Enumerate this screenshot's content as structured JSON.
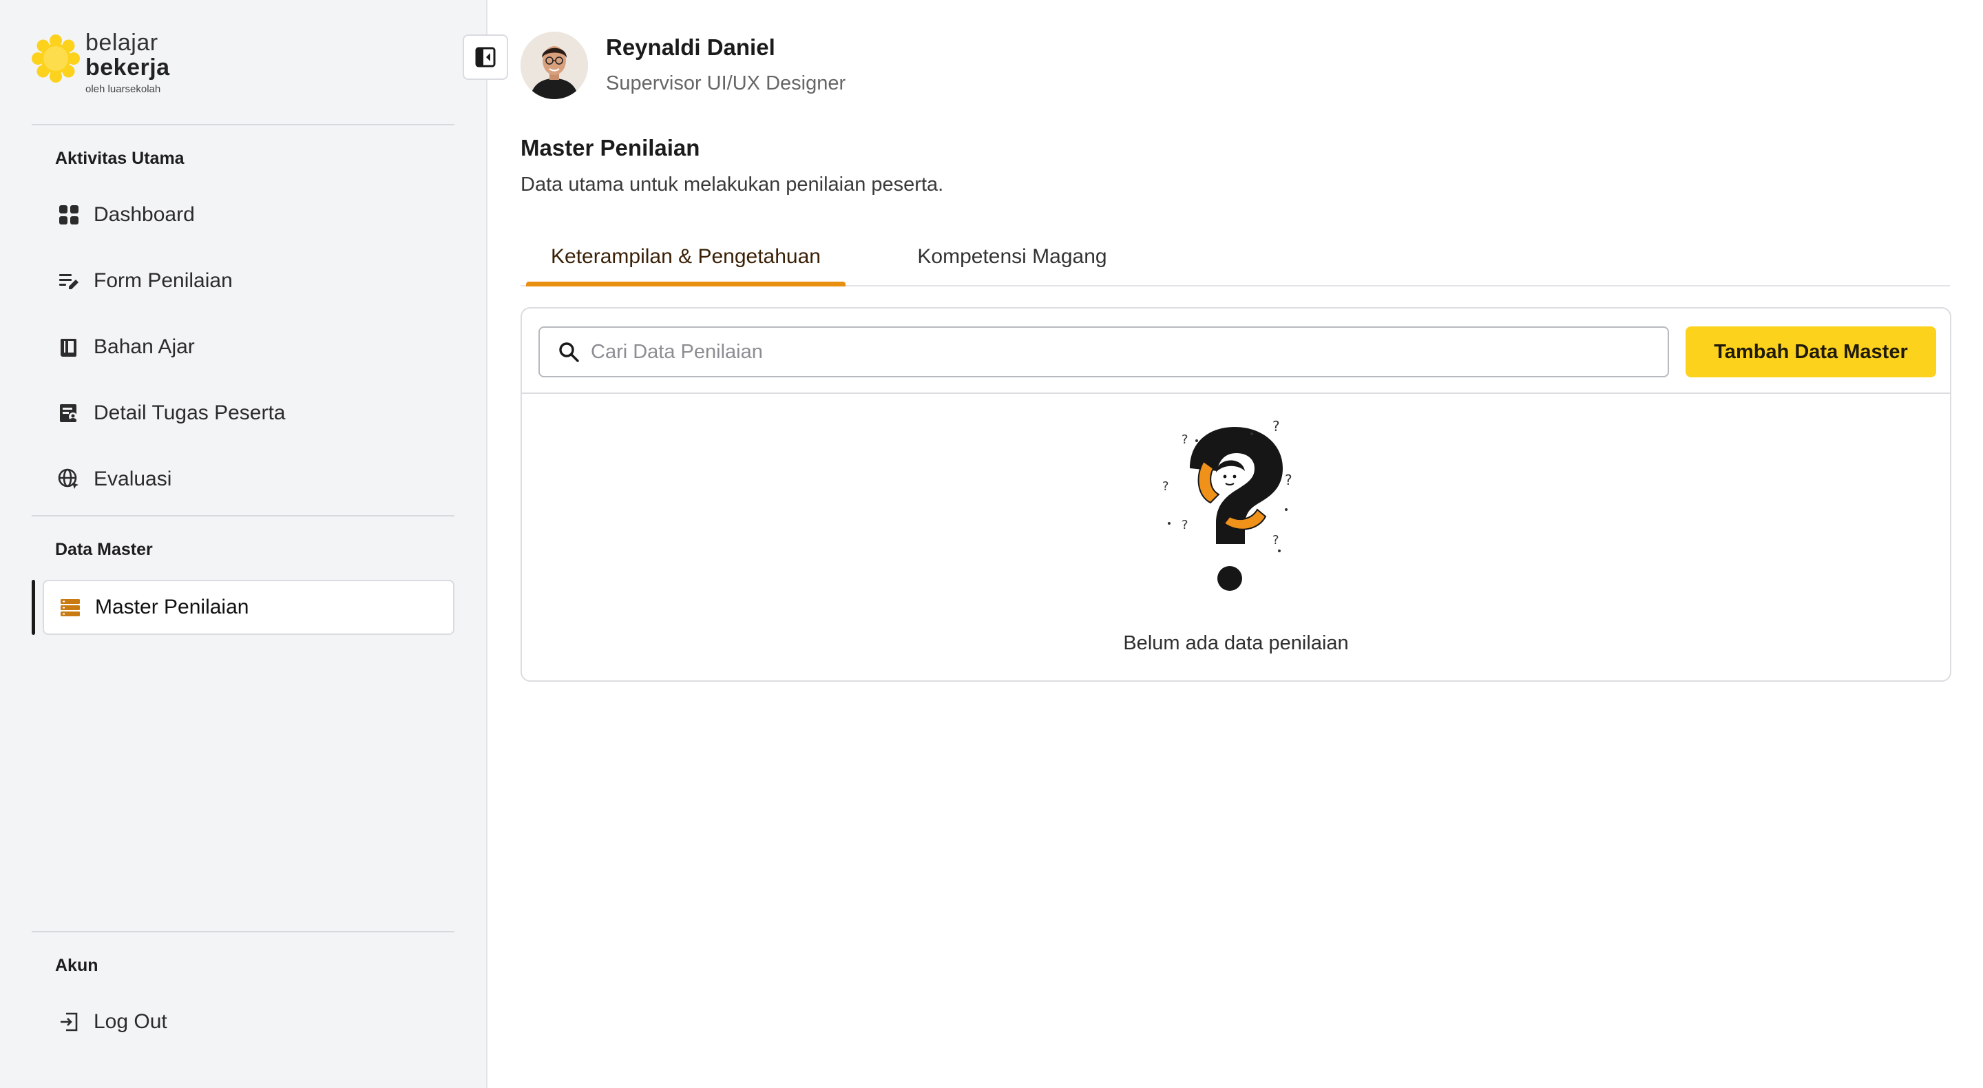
{
  "brand": {
    "line1": "belajar",
    "line2": "bekerja",
    "tagline": "oleh luarsekolah",
    "sun_color": "#fcd21d"
  },
  "sidebar": {
    "sections": [
      {
        "title": "Aktivitas Utama",
        "items": [
          {
            "label": "Dashboard",
            "icon": "grid-icon"
          },
          {
            "label": "Form Penilaian",
            "icon": "edit-list-icon"
          },
          {
            "label": "Bahan Ajar",
            "icon": "book-icon"
          },
          {
            "label": "Detail Tugas Peserta",
            "icon": "task-detail-icon"
          },
          {
            "label": "Evaluasi",
            "icon": "globe-icon"
          }
        ]
      },
      {
        "title": "Data Master",
        "items": [
          {
            "label": "Master Penilaian",
            "icon": "database-icon",
            "active": true
          }
        ]
      },
      {
        "title": "Akun",
        "items": [
          {
            "label": "Log Out",
            "icon": "logout-icon"
          }
        ]
      }
    ]
  },
  "profile": {
    "name": "Reynaldi Daniel",
    "role": "Supervisor UI/UX Designer"
  },
  "page": {
    "title": "Master Penilaian",
    "subtitle": "Data utama untuk melakukan penilaian peserta."
  },
  "tabs": [
    {
      "label": "Keterampilan & Pengetahuan",
      "active": true
    },
    {
      "label": "Kompetensi Magang",
      "active": false
    }
  ],
  "toolbar": {
    "search_placeholder": "Cari Data Penilaian",
    "search_value": "",
    "add_label": "Tambah Data Master"
  },
  "empty_state": {
    "message": "Belum ada data penilaian"
  },
  "colors": {
    "accent": "#fcd21d",
    "tab_underline": "#e88f10",
    "active_icon": "#c97a10"
  }
}
